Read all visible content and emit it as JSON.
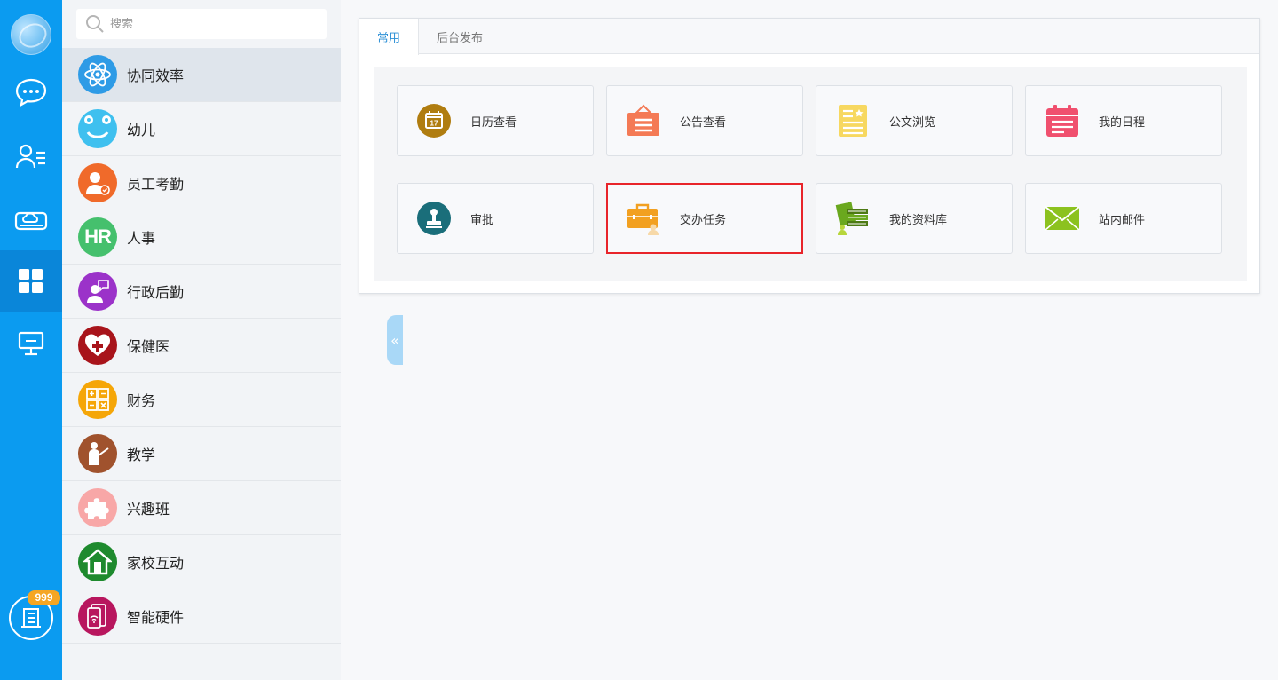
{
  "rail": {
    "items": [
      {
        "name": "chat-icon"
      },
      {
        "name": "contacts-icon"
      },
      {
        "name": "cloud-drive-icon"
      },
      {
        "name": "apps-grid-icon",
        "active": true
      },
      {
        "name": "monitor-icon"
      }
    ],
    "badge": "999",
    "bottom_icon": "building-icon"
  },
  "search": {
    "placeholder": "搜索"
  },
  "categories": [
    {
      "label": "协同效率",
      "icon": "atom-icon",
      "color": "#2e9be6",
      "active": true
    },
    {
      "label": "幼儿",
      "icon": "smiley-icon",
      "color": "#3fc0ef"
    },
    {
      "label": "员工考勤",
      "icon": "employee-clock-icon",
      "color": "#f06a2a"
    },
    {
      "label": "人事",
      "icon": "hr-icon",
      "color": "#45c06d"
    },
    {
      "label": "行政后勤",
      "icon": "admin-service-icon",
      "color": "#9b32c9"
    },
    {
      "label": "保健医",
      "icon": "heart-cross-icon",
      "color": "#a8141b"
    },
    {
      "label": "财务",
      "icon": "calculator-icon",
      "color": "#f5a608"
    },
    {
      "label": "教学",
      "icon": "teacher-icon",
      "color": "#a0522d"
    },
    {
      "label": "兴趣班",
      "icon": "puzzle-icon",
      "color": "#f8a7a7"
    },
    {
      "label": "家校互动",
      "icon": "house-icon",
      "color": "#1e8a2e"
    },
    {
      "label": "智能硬件",
      "icon": "smart-device-icon",
      "color": "#b8165e"
    }
  ],
  "tabs": [
    {
      "label": "常用",
      "active": true
    },
    {
      "label": "后台发布"
    }
  ],
  "apps": [
    {
      "label": "日历查看",
      "icon": "calendar-icon",
      "color": "#b07d10"
    },
    {
      "label": "公告查看",
      "icon": "announcement-icon",
      "color": "#f47a55"
    },
    {
      "label": "公文浏览",
      "icon": "document-icon",
      "color": "#f7d860"
    },
    {
      "label": "我的日程",
      "icon": "schedule-icon",
      "color": "#f0506e"
    },
    {
      "label": "审批",
      "icon": "stamp-icon",
      "color": "#1a6e7a"
    },
    {
      "label": "交办任务",
      "icon": "briefcase-icon",
      "color": "#f2a020",
      "selected": true
    },
    {
      "label": "我的资料库",
      "icon": "library-icon",
      "color": "#6aa81e"
    },
    {
      "label": "站内邮件",
      "icon": "mail-icon",
      "color": "#8cc21f"
    }
  ]
}
